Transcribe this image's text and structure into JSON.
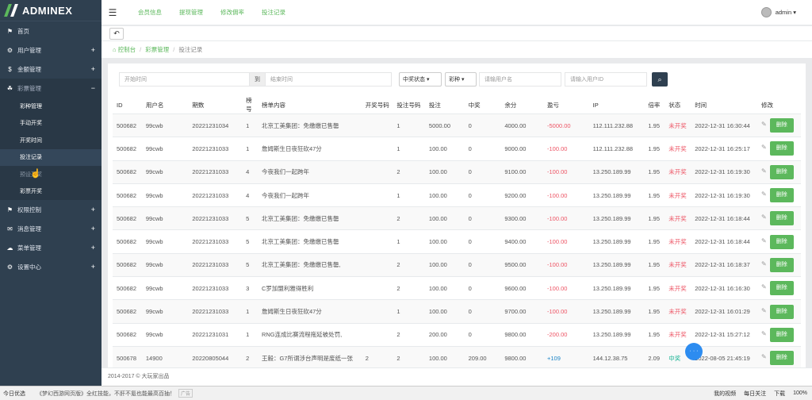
{
  "app": {
    "logo": "ADMINEX"
  },
  "sidebar": {
    "items": [
      {
        "icon": "⚑",
        "icon_name": "flag-icon",
        "label": "首页",
        "plus": ""
      },
      {
        "icon": "⚙",
        "icon_name": "gear-icon",
        "label": "用户管理",
        "plus": "+"
      },
      {
        "icon": "$",
        "icon_name": "dollar-icon",
        "label": "金额管理",
        "plus": "+"
      },
      {
        "icon": "☘",
        "icon_name": "leaf-icon",
        "label": "彩票管理",
        "plus": "−"
      }
    ],
    "sub": [
      "彩种管理",
      "手动开奖",
      "开奖时间",
      "投注记录",
      "预设开奖",
      "彩票开奖"
    ],
    "items2": [
      {
        "icon": "⚑",
        "icon_name": "flag-icon",
        "label": "权限控制",
        "plus": "+"
      },
      {
        "icon": "✉",
        "icon_name": "mail-icon",
        "label": "消息管理",
        "plus": "+"
      },
      {
        "icon": "☁",
        "icon_name": "cloud-icon",
        "label": "菜单管理",
        "plus": "+"
      },
      {
        "icon": "⚙",
        "icon_name": "gear-icon",
        "label": "设置中心",
        "plus": "+"
      }
    ]
  },
  "topbar": {
    "links": [
      "会员信息",
      "提现管理",
      "修改佣率",
      "投注记录"
    ],
    "user": "admin ▾"
  },
  "breadcrumb": {
    "home": "控制台",
    "section": "彩票管理",
    "current": "投注记录"
  },
  "search": {
    "start_placeholder": "开始时间",
    "to": "到",
    "end_placeholder": "结束时间",
    "status_select": "中奖状态",
    "type_select": "彩种",
    "user_placeholder": "请输用户名",
    "uid_placeholder": "请输入用户ID"
  },
  "table": {
    "headers": [
      "ID",
      "用户名",
      "期数",
      "榜号",
      "榜单内容",
      "开奖号码",
      "投注号码",
      "投注",
      "中奖",
      "余分",
      "盈亏",
      "IP",
      "倍率",
      "状态",
      "时间",
      "修改"
    ],
    "delete_label": "删除",
    "rows": [
      [
        "500682",
        "99cwb",
        "20221231034",
        "1",
        "北京工美集团：免缴缴已售罄",
        "",
        "1",
        "5000.00",
        "0",
        "4000.00",
        "-5000.00",
        "112.111.232.88",
        "1.95",
        "未开奖",
        "2022-12-31 16:30:44"
      ],
      [
        "500682",
        "99cwb",
        "20221231033",
        "1",
        "詹姆斯生日夜狂砍47分",
        "",
        "1",
        "100.00",
        "0",
        "9000.00",
        "-100.00",
        "112.111.232.88",
        "1.95",
        "未开奖",
        "2022-12-31 16:25:17"
      ],
      [
        "500682",
        "99cwb",
        "20221231033",
        "4",
        "今夜我们一起跨年",
        "",
        "2",
        "100.00",
        "0",
        "9100.00",
        "-100.00",
        "13.250.189.99",
        "1.95",
        "未开奖",
        "2022-12-31 16:19:30"
      ],
      [
        "500682",
        "99cwb",
        "20221231033",
        "4",
        "今夜我们一起跨年",
        "",
        "1",
        "100.00",
        "0",
        "9200.00",
        "-100.00",
        "13.250.189.99",
        "1.95",
        "未开奖",
        "2022-12-31 16:19:30"
      ],
      [
        "500682",
        "99cwb",
        "20221231033",
        "5",
        "北京工美集团：免缴缴已售罄",
        "",
        "2",
        "100.00",
        "0",
        "9300.00",
        "-100.00",
        "13.250.189.99",
        "1.95",
        "未开奖",
        "2022-12-31 16:18:44"
      ],
      [
        "500682",
        "99cwb",
        "20221231033",
        "5",
        "北京工美集团：免缴缴已售罄",
        "",
        "1",
        "100.00",
        "0",
        "9400.00",
        "-100.00",
        "13.250.189.99",
        "1.95",
        "未开奖",
        "2022-12-31 16:18:44"
      ],
      [
        "500682",
        "99cwb",
        "20221231033",
        "5",
        "北京工美集团：免缴缴已售罄,",
        "",
        "2",
        "100.00",
        "0",
        "9500.00",
        "-100.00",
        "13.250.189.99",
        "1.95",
        "未开奖",
        "2022-12-31 16:18:37"
      ],
      [
        "500682",
        "99cwb",
        "20221231033",
        "3",
        "C罗加盟利雅得胜利",
        "",
        "2",
        "100.00",
        "0",
        "9600.00",
        "-100.00",
        "13.250.189.99",
        "1.95",
        "未开奖",
        "2022-12-31 16:16:30"
      ],
      [
        "500682",
        "99cwb",
        "20221231033",
        "1",
        "詹姆斯生日夜狂砍47分",
        "",
        "1",
        "100.00",
        "0",
        "9700.00",
        "-100.00",
        "13.250.189.99",
        "1.95",
        "未开奖",
        "2022-12-31 16:01:29"
      ],
      [
        "500682",
        "99cwb",
        "20221231031",
        "1",
        "RNG连成比赛流程拖延被处罚,",
        "",
        "2",
        "200.00",
        "0",
        "9800.00",
        "-200.00",
        "13.250.189.99",
        "1.95",
        "未开奖",
        "2022-12-31 15:27:12"
      ],
      [
        "500678",
        "14900",
        "20220805044",
        "2",
        "王毅：G7所谓涉台声明是废纸一张",
        "2",
        "2",
        "100.00",
        "209.00",
        "9800.00",
        "+109",
        "144.12.38.75",
        "2.09",
        "中奖",
        "2022-08-05 21:45:19"
      ]
    ]
  },
  "footer": {
    "text": "2014-2017 © 大玩家出品"
  },
  "taskbar": {
    "left": "今日优选",
    "news": "《梦幻西游网页版》全红技能，不肝不氪也能最高百抽！",
    "ad": "广告",
    "right": [
      "我的视频",
      "每日关注",
      "下载",
      "100%"
    ]
  },
  "colors": {
    "sidebar": "#2f4050",
    "accent": "#5cb85c",
    "negative": "#ed5565",
    "positive": "#1c84c6"
  }
}
